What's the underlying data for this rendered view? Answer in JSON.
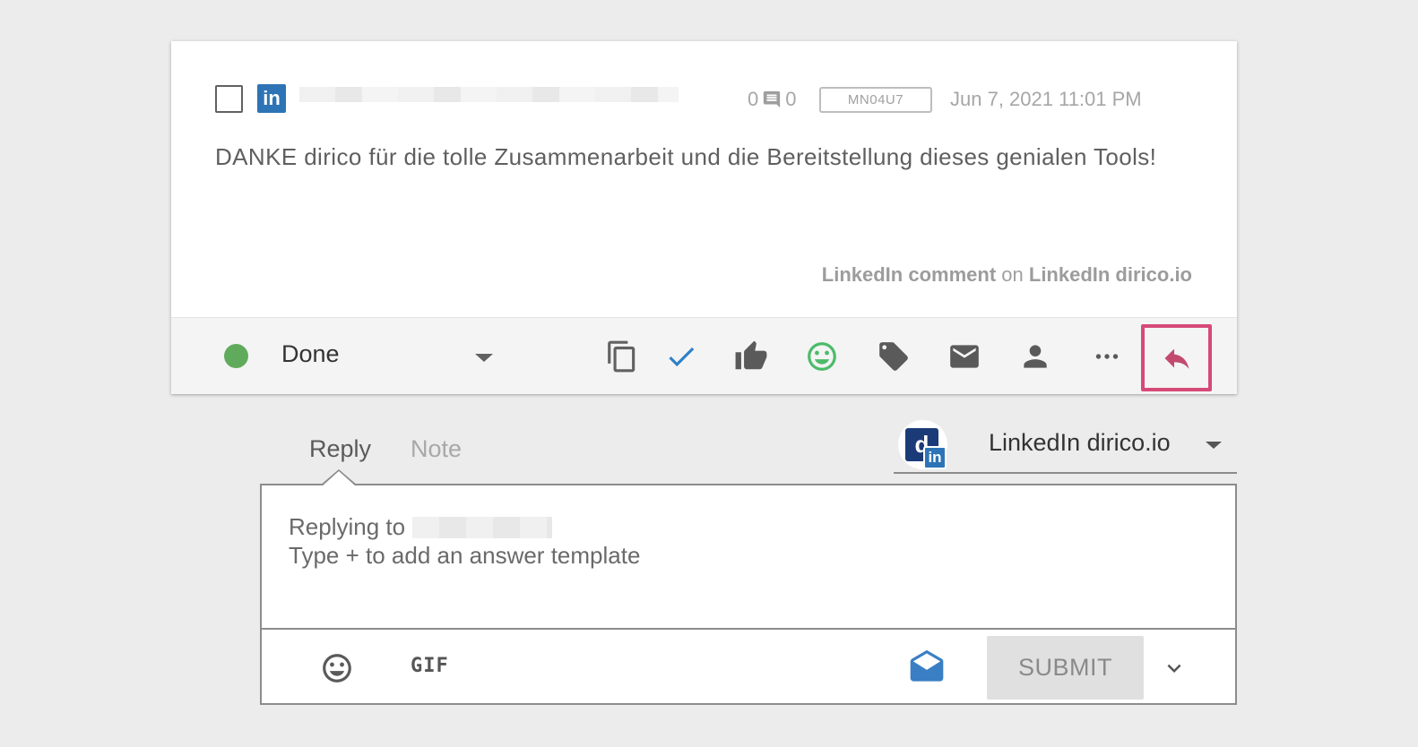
{
  "post": {
    "network_badge": "in",
    "reply_count_left": "0",
    "reply_count_right": "0",
    "id_badge": "MN04U7",
    "date": "Jun 7, 2021 11:01 PM",
    "message": "DANKE dirico für die tolle Zusammenarbeit und die Bereitstellung dieses genialen Tools!",
    "source": {
      "type": "LinkedIn comment",
      "connector": "on",
      "account": "LinkedIn dirico.io"
    }
  },
  "toolbar": {
    "status_label": "Done",
    "status_color": "#5fab5b",
    "icons": [
      "copy-icon",
      "check-icon",
      "thumbs-up-icon",
      "smiley-icon",
      "tag-icon",
      "mail-icon",
      "person-icon",
      "more-icon",
      "reply-icon"
    ],
    "reply_highlight_color": "#d64a78"
  },
  "reply_panel": {
    "tabs": [
      "Reply",
      "Note"
    ],
    "active_tab": "Reply",
    "account_name": "LinkedIn dirico.io",
    "account_logo_letter": "d",
    "account_network_badge": "in",
    "replying_to_label": "Replying to",
    "placeholder": "Type + to add an answer template",
    "gif_label": "GIF",
    "submit_label": "SUBMIT"
  }
}
